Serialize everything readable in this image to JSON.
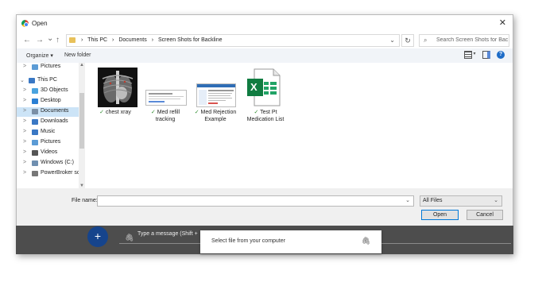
{
  "dialog": {
    "title": "Open",
    "close_glyph": "✕",
    "nav": {
      "back": "←",
      "forward": "→",
      "recent": "⌄",
      "up": "↑"
    },
    "address": {
      "crumbs": [
        "›",
        "This PC",
        "›",
        "Documents",
        "›",
        "Screen Shots for Backline"
      ],
      "dropdown": "⌄"
    },
    "refresh_glyph": "↻",
    "search": {
      "icon": "⌕",
      "placeholder": "Search Screen Shots for Back..."
    },
    "commandbar": {
      "organize": "Organize ▾",
      "new_folder": "New folder",
      "view_dropdown": "▾",
      "help": "?"
    },
    "sidebar": {
      "items": [
        {
          "label": "Pictures",
          "arrow": ">",
          "icon": "pictures-icon",
          "color": "#5b9bd5"
        },
        {
          "label": "This PC",
          "arrow": "⌄",
          "icon": "pc-icon",
          "color": "#3a78c4"
        },
        {
          "label": "3D Objects",
          "arrow": ">",
          "icon": "cube-icon",
          "color": "#4aa3df"
        },
        {
          "label": "Desktop",
          "arrow": ">",
          "icon": "desktop-icon",
          "color": "#2a7fd4"
        },
        {
          "label": "Documents",
          "arrow": ">",
          "icon": "documents-icon",
          "color": "#7a8fa6"
        },
        {
          "label": "Downloads",
          "arrow": ">",
          "icon": "download-icon",
          "color": "#3a78c4"
        },
        {
          "label": "Music",
          "arrow": ">",
          "icon": "music-icon",
          "color": "#3a78c4"
        },
        {
          "label": "Pictures",
          "arrow": ">",
          "icon": "pictures-icon",
          "color": "#5b9bd5"
        },
        {
          "label": "Videos",
          "arrow": ">",
          "icon": "video-icon",
          "color": "#555555"
        },
        {
          "label": "Windows (C:)",
          "arrow": ">",
          "icon": "drive-icon",
          "color": "#6f8fb0"
        },
        {
          "label": "PowerBroker sof",
          "arrow": ">",
          "icon": "network-drive-icon",
          "color": "#777777"
        }
      ]
    },
    "files": [
      {
        "name": "chest xray",
        "status": "✓",
        "kind": "xray"
      },
      {
        "name": "Med refill tracking",
        "status": "✓",
        "kind": "doc"
      },
      {
        "name": "Med Rejection Example",
        "status": "✓",
        "kind": "screenshot"
      },
      {
        "name": "Test Pt Medication List",
        "status": "✓",
        "kind": "excel"
      }
    ],
    "file_name_label": "File name:",
    "file_name_value": "",
    "dropdown_glyph": "⌄",
    "filter": "All Files",
    "open_button": "Open",
    "cancel_button": "Cancel",
    "excel_letter": "X"
  },
  "chat": {
    "add_glyph": "+",
    "attach_glyph": "🖇",
    "message_placeholder": "Type a message (Shift +",
    "popup_text": "Select file from your computer"
  }
}
